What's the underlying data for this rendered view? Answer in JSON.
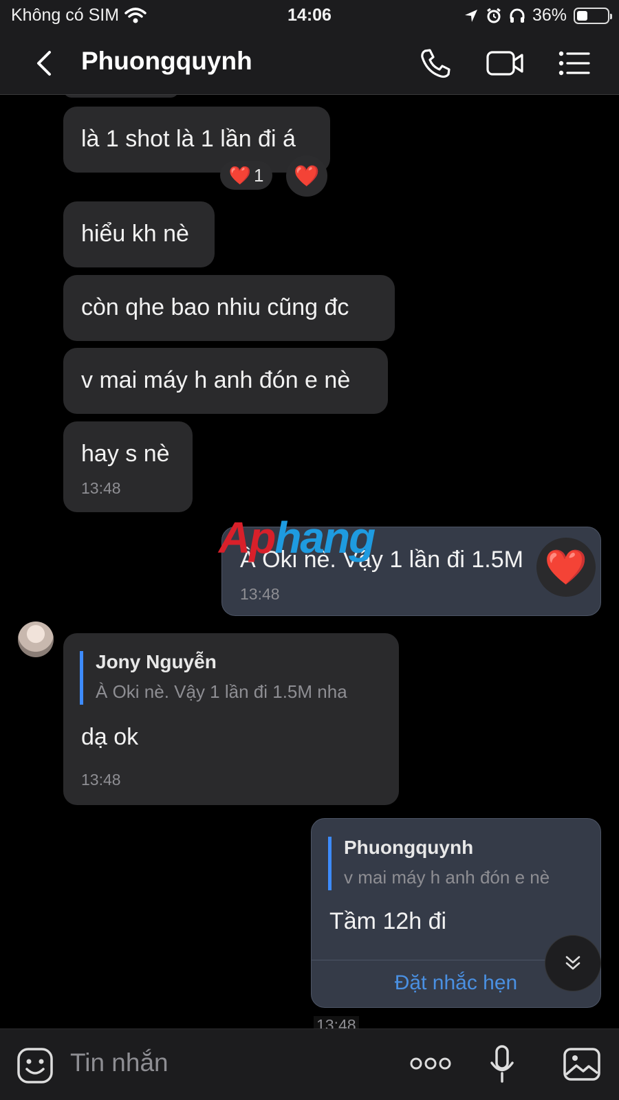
{
  "status_bar": {
    "carrier": "Không có SIM",
    "time": "14:06",
    "battery": "36%",
    "battery_level": 0.36
  },
  "header": {
    "title": "Phuongquynh",
    "icons": [
      "back-chevron-icon",
      "phone-icon",
      "video-camera-icon",
      "list-menu-icon"
    ]
  },
  "messages": [
    {
      "side": "received",
      "text": "là 1 shot là 1 lần đi á",
      "reaction": "❤️",
      "reaction_count": "1",
      "reaction_button": "❤️"
    },
    {
      "side": "received",
      "text": "hiểu kh nè"
    },
    {
      "side": "received",
      "text": "còn qhe bao nhiu cũng đc"
    },
    {
      "side": "received",
      "text": "v mai máy h anh đón e nè"
    },
    {
      "side": "received",
      "text": "hay s nè",
      "time": "13:48"
    },
    {
      "side": "sent",
      "text": "À Oki nè. Vậy 1 lần đi 1.5M",
      "time": "13:48",
      "reaction": "❤️"
    },
    {
      "side": "received",
      "quote_name": "Jony Nguyễn",
      "quote_text": "À Oki nè. Vậy 1 lần đi 1.5M nha",
      "text": "dạ ok",
      "time": "13:48"
    },
    {
      "side": "sent",
      "quote_name": "Phuongquynh",
      "quote_text": "v mai máy h anh đón e nè",
      "text": "Tầm 12h đi",
      "action": "Đặt nhắc hẹn",
      "time": "13:48"
    }
  ],
  "watermark": {
    "part1": "Ap",
    "part2": "hang"
  },
  "composer": {
    "placeholder": "Tin nhắn",
    "icons": [
      "sticker-icon",
      "more-icon",
      "microphone-icon",
      "image-icon"
    ]
  },
  "colors": {
    "background": "#000000",
    "received_bubble": "#2a2a2c",
    "sent_bubble": "#353b48",
    "accent": "#3d8bfd",
    "link": "#4a90e2",
    "timestamp": "#8e8e93"
  }
}
